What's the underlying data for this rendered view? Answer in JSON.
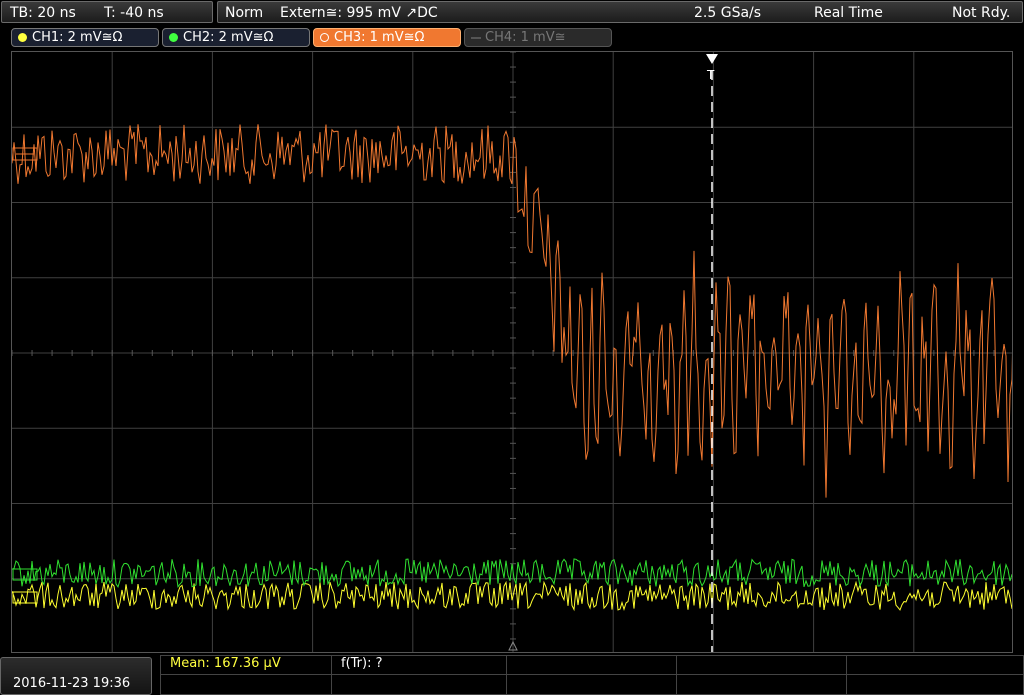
{
  "topbar": {
    "timebase": "TB: 20 ns",
    "trigger_time": "T: -40 ns",
    "acq_mode": "Norm",
    "trigger_source": "Extern≅: 995 mV ↗DC",
    "sample_rate": "2.5 GSa/s",
    "sampling_mode": "Real Time",
    "trigger_status": "Not Rdy."
  },
  "channels": [
    {
      "label": "CH1: 2 mV≅Ω",
      "color": "#ffff40",
      "state": "on"
    },
    {
      "label": "CH2: 2 mV≅Ω",
      "color": "#40ff40",
      "state": "on"
    },
    {
      "label": "CH3: 1 mV≅Ω",
      "color": "#f07830",
      "state": "active"
    },
    {
      "label": "CH4: 1 mV≅",
      "color": "#666666",
      "state": "off"
    }
  ],
  "markers": {
    "trigger_marker": "T"
  },
  "bottom": {
    "datetime": "2016-11-23 19:36",
    "meas1": "Mean: 167.36 µV",
    "meas2": "f(Tr): ?"
  },
  "colors": {
    "ch1": "#ffff30",
    "ch2": "#30e030",
    "ch3": "#f07830",
    "grid": "#404040",
    "meas_highlight": "#ffff40"
  }
}
